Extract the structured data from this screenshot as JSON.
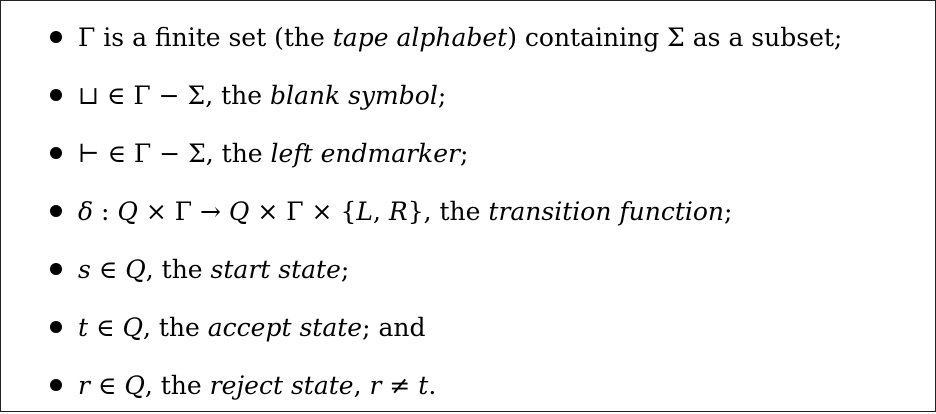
{
  "items": [
    {
      "parts": [
        {
          "t": "Γ is a finite set (the ",
          "i": false
        },
        {
          "t": "tape alphabet",
          "i": true
        },
        {
          "t": ") containing Σ as a subset;",
          "i": false
        }
      ]
    },
    {
      "parts": [
        {
          "t": "⊔ ∈ Γ − Σ, the ",
          "i": false
        },
        {
          "t": "blank symbol",
          "i": true
        },
        {
          "t": ";",
          "i": false
        }
      ]
    },
    {
      "parts": [
        {
          "t": "⊢ ∈ Γ − Σ, the ",
          "i": false
        },
        {
          "t": "left endmarker",
          "i": true
        },
        {
          "t": ";",
          "i": false
        }
      ]
    },
    {
      "parts": [
        {
          "t": "δ",
          "i": true
        },
        {
          "t": " : ",
          "i": false
        },
        {
          "t": "Q",
          "i": true
        },
        {
          "t": " × Γ → ",
          "i": false
        },
        {
          "t": "Q",
          "i": true
        },
        {
          "t": " × Γ × {",
          "i": false
        },
        {
          "t": "L",
          "i": true
        },
        {
          "t": ", ",
          "i": false
        },
        {
          "t": "R",
          "i": true
        },
        {
          "t": "}, the ",
          "i": false
        },
        {
          "t": "transition function",
          "i": true
        },
        {
          "t": ";",
          "i": false
        }
      ]
    },
    {
      "parts": [
        {
          "t": "s",
          "i": true
        },
        {
          "t": " ∈ ",
          "i": false
        },
        {
          "t": "Q",
          "i": true
        },
        {
          "t": ", the ",
          "i": false
        },
        {
          "t": "start state",
          "i": true
        },
        {
          "t": ";",
          "i": false
        }
      ]
    },
    {
      "parts": [
        {
          "t": "t",
          "i": true
        },
        {
          "t": " ∈ ",
          "i": false
        },
        {
          "t": "Q",
          "i": true
        },
        {
          "t": ", the ",
          "i": false
        },
        {
          "t": "accept state",
          "i": true
        },
        {
          "t": "; and",
          "i": false
        }
      ]
    },
    {
      "parts": [
        {
          "t": "r",
          "i": true
        },
        {
          "t": " ∈ ",
          "i": false
        },
        {
          "t": "Q",
          "i": true
        },
        {
          "t": ", the ",
          "i": false
        },
        {
          "t": "reject state",
          "i": true
        },
        {
          "t": ", ",
          "i": false
        },
        {
          "t": "r",
          "i": true
        },
        {
          "t": " ≠ ",
          "i": false
        },
        {
          "t": "t",
          "i": true
        },
        {
          "t": ".",
          "i": false
        }
      ]
    }
  ]
}
